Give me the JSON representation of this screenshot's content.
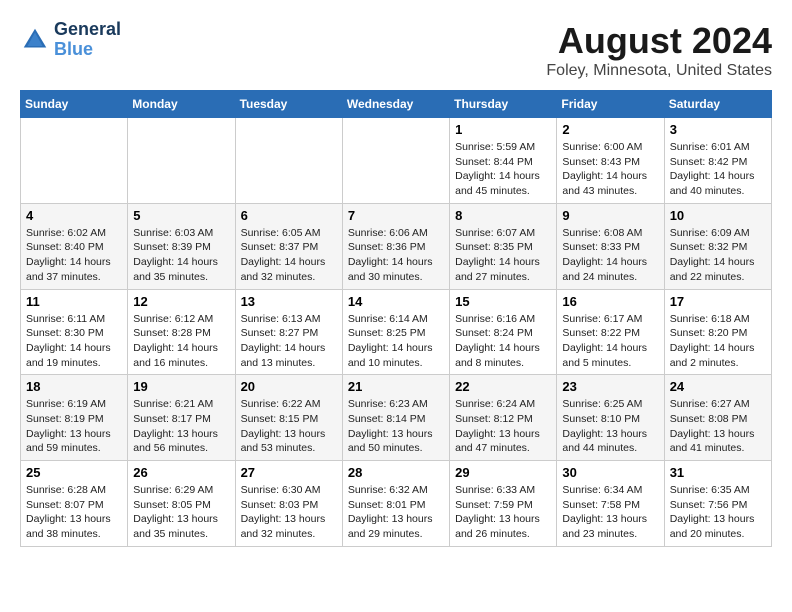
{
  "header": {
    "logo_line1": "General",
    "logo_line2": "Blue",
    "month_year": "August 2024",
    "location": "Foley, Minnesota, United States"
  },
  "days_of_week": [
    "Sunday",
    "Monday",
    "Tuesday",
    "Wednesday",
    "Thursday",
    "Friday",
    "Saturday"
  ],
  "weeks": [
    [
      {
        "day": "",
        "info": ""
      },
      {
        "day": "",
        "info": ""
      },
      {
        "day": "",
        "info": ""
      },
      {
        "day": "",
        "info": ""
      },
      {
        "day": "1",
        "info": "Sunrise: 5:59 AM\nSunset: 8:44 PM\nDaylight: 14 hours\nand 45 minutes."
      },
      {
        "day": "2",
        "info": "Sunrise: 6:00 AM\nSunset: 8:43 PM\nDaylight: 14 hours\nand 43 minutes."
      },
      {
        "day": "3",
        "info": "Sunrise: 6:01 AM\nSunset: 8:42 PM\nDaylight: 14 hours\nand 40 minutes."
      }
    ],
    [
      {
        "day": "4",
        "info": "Sunrise: 6:02 AM\nSunset: 8:40 PM\nDaylight: 14 hours\nand 37 minutes."
      },
      {
        "day": "5",
        "info": "Sunrise: 6:03 AM\nSunset: 8:39 PM\nDaylight: 14 hours\nand 35 minutes."
      },
      {
        "day": "6",
        "info": "Sunrise: 6:05 AM\nSunset: 8:37 PM\nDaylight: 14 hours\nand 32 minutes."
      },
      {
        "day": "7",
        "info": "Sunrise: 6:06 AM\nSunset: 8:36 PM\nDaylight: 14 hours\nand 30 minutes."
      },
      {
        "day": "8",
        "info": "Sunrise: 6:07 AM\nSunset: 8:35 PM\nDaylight: 14 hours\nand 27 minutes."
      },
      {
        "day": "9",
        "info": "Sunrise: 6:08 AM\nSunset: 8:33 PM\nDaylight: 14 hours\nand 24 minutes."
      },
      {
        "day": "10",
        "info": "Sunrise: 6:09 AM\nSunset: 8:32 PM\nDaylight: 14 hours\nand 22 minutes."
      }
    ],
    [
      {
        "day": "11",
        "info": "Sunrise: 6:11 AM\nSunset: 8:30 PM\nDaylight: 14 hours\nand 19 minutes."
      },
      {
        "day": "12",
        "info": "Sunrise: 6:12 AM\nSunset: 8:28 PM\nDaylight: 14 hours\nand 16 minutes."
      },
      {
        "day": "13",
        "info": "Sunrise: 6:13 AM\nSunset: 8:27 PM\nDaylight: 14 hours\nand 13 minutes."
      },
      {
        "day": "14",
        "info": "Sunrise: 6:14 AM\nSunset: 8:25 PM\nDaylight: 14 hours\nand 10 minutes."
      },
      {
        "day": "15",
        "info": "Sunrise: 6:16 AM\nSunset: 8:24 PM\nDaylight: 14 hours\nand 8 minutes."
      },
      {
        "day": "16",
        "info": "Sunrise: 6:17 AM\nSunset: 8:22 PM\nDaylight: 14 hours\nand 5 minutes."
      },
      {
        "day": "17",
        "info": "Sunrise: 6:18 AM\nSunset: 8:20 PM\nDaylight: 14 hours\nand 2 minutes."
      }
    ],
    [
      {
        "day": "18",
        "info": "Sunrise: 6:19 AM\nSunset: 8:19 PM\nDaylight: 13 hours\nand 59 minutes."
      },
      {
        "day": "19",
        "info": "Sunrise: 6:21 AM\nSunset: 8:17 PM\nDaylight: 13 hours\nand 56 minutes."
      },
      {
        "day": "20",
        "info": "Sunrise: 6:22 AM\nSunset: 8:15 PM\nDaylight: 13 hours\nand 53 minutes."
      },
      {
        "day": "21",
        "info": "Sunrise: 6:23 AM\nSunset: 8:14 PM\nDaylight: 13 hours\nand 50 minutes."
      },
      {
        "day": "22",
        "info": "Sunrise: 6:24 AM\nSunset: 8:12 PM\nDaylight: 13 hours\nand 47 minutes."
      },
      {
        "day": "23",
        "info": "Sunrise: 6:25 AM\nSunset: 8:10 PM\nDaylight: 13 hours\nand 44 minutes."
      },
      {
        "day": "24",
        "info": "Sunrise: 6:27 AM\nSunset: 8:08 PM\nDaylight: 13 hours\nand 41 minutes."
      }
    ],
    [
      {
        "day": "25",
        "info": "Sunrise: 6:28 AM\nSunset: 8:07 PM\nDaylight: 13 hours\nand 38 minutes."
      },
      {
        "day": "26",
        "info": "Sunrise: 6:29 AM\nSunset: 8:05 PM\nDaylight: 13 hours\nand 35 minutes."
      },
      {
        "day": "27",
        "info": "Sunrise: 6:30 AM\nSunset: 8:03 PM\nDaylight: 13 hours\nand 32 minutes."
      },
      {
        "day": "28",
        "info": "Sunrise: 6:32 AM\nSunset: 8:01 PM\nDaylight: 13 hours\nand 29 minutes."
      },
      {
        "day": "29",
        "info": "Sunrise: 6:33 AM\nSunset: 7:59 PM\nDaylight: 13 hours\nand 26 minutes."
      },
      {
        "day": "30",
        "info": "Sunrise: 6:34 AM\nSunset: 7:58 PM\nDaylight: 13 hours\nand 23 minutes."
      },
      {
        "day": "31",
        "info": "Sunrise: 6:35 AM\nSunset: 7:56 PM\nDaylight: 13 hours\nand 20 minutes."
      }
    ]
  ]
}
